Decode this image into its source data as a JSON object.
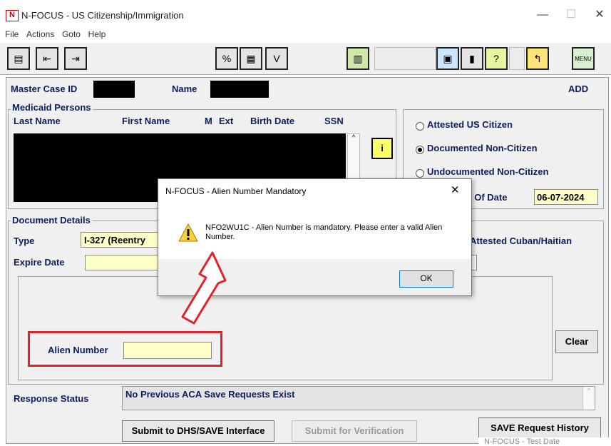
{
  "window": {
    "title": "N-FOCUS - US Citizenship/Immigration",
    "icon_text": "N",
    "minimize": "—",
    "maximize": "☐",
    "close": "✕"
  },
  "menu": [
    "File",
    "Actions",
    "Goto",
    "Help"
  ],
  "header": {
    "master_case_label": "Master Case ID",
    "name_label": "Name",
    "mode": "ADD"
  },
  "medicaid": {
    "group_label": "Medicaid Persons",
    "columns": [
      "Last Name",
      "First Name",
      "M",
      "Ext",
      "Birth Date",
      "SSN"
    ]
  },
  "citizenship": {
    "options": [
      "Attested US Citizen",
      "Documented Non-Citizen",
      "Undocumented Non-Citizen"
    ],
    "selected": "Documented Non-Citizen",
    "as_of_label": "As Of Date",
    "as_of_value": "06-07-2024",
    "cuban_haitian_label": "Attested Cuban/Haitian"
  },
  "document": {
    "group_label": "Document Details",
    "type_label": "Type",
    "type_value": "I-327 (Reentry",
    "expire_label": "Expire Date",
    "alien_label": "Alien Number"
  },
  "buttons": {
    "clear": "Clear",
    "submit_dhs": "Submit to DHS/SAVE Interface",
    "submit_verify": "Submit for Verification",
    "save_history": "SAVE Request History"
  },
  "response": {
    "label": "Response Status",
    "value": "No Previous ACA Save Requests Exist"
  },
  "partial_text": "N-FOCUS - Test Date",
  "dialog": {
    "title": "N-FOCUS - Alien Number Mandatory",
    "message": "NFO2WU1C - Alien Number is mandatory. Please enter a valid Alien Number.",
    "ok": "OK",
    "close": "✕",
    "icon": "warning-icon"
  },
  "annotation": {
    "highlight_color": "#e0232a",
    "arrow": "red-arrow"
  }
}
